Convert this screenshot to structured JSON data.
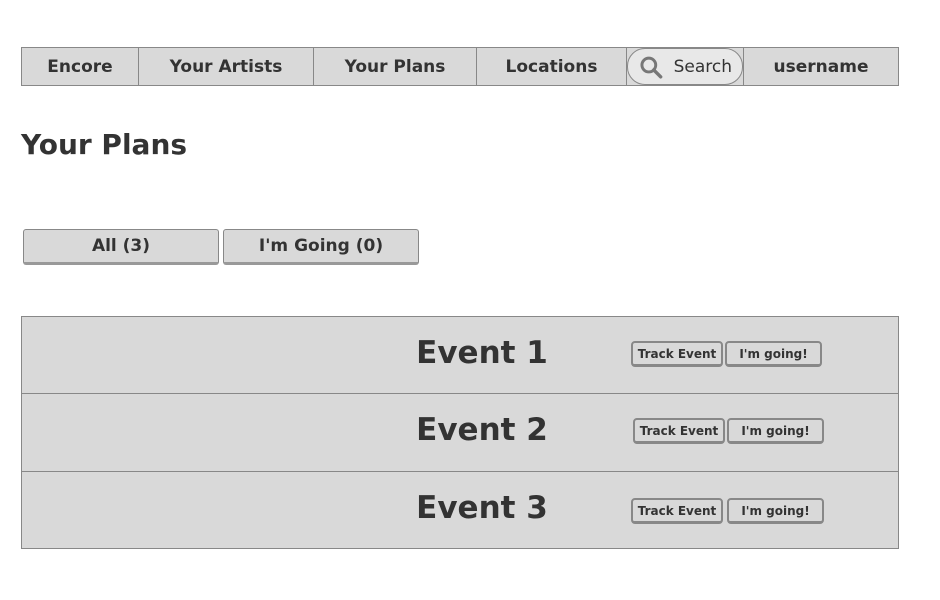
{
  "nav": {
    "items": [
      "Encore",
      "Your Artists",
      "Your Plans",
      "Locations"
    ],
    "search_placeholder": "Search",
    "user": "username"
  },
  "page_title": "Your Plans",
  "tabs": [
    "All (3)",
    "I'm Going (0)"
  ],
  "events": [
    {
      "name": "Event 1",
      "track": "Track Event",
      "going": "I'm going!"
    },
    {
      "name": "Event 2",
      "track": "Track Event",
      "going": "I'm going!"
    },
    {
      "name": "Event 3",
      "track": "Track Event",
      "going": "I'm going!"
    }
  ]
}
